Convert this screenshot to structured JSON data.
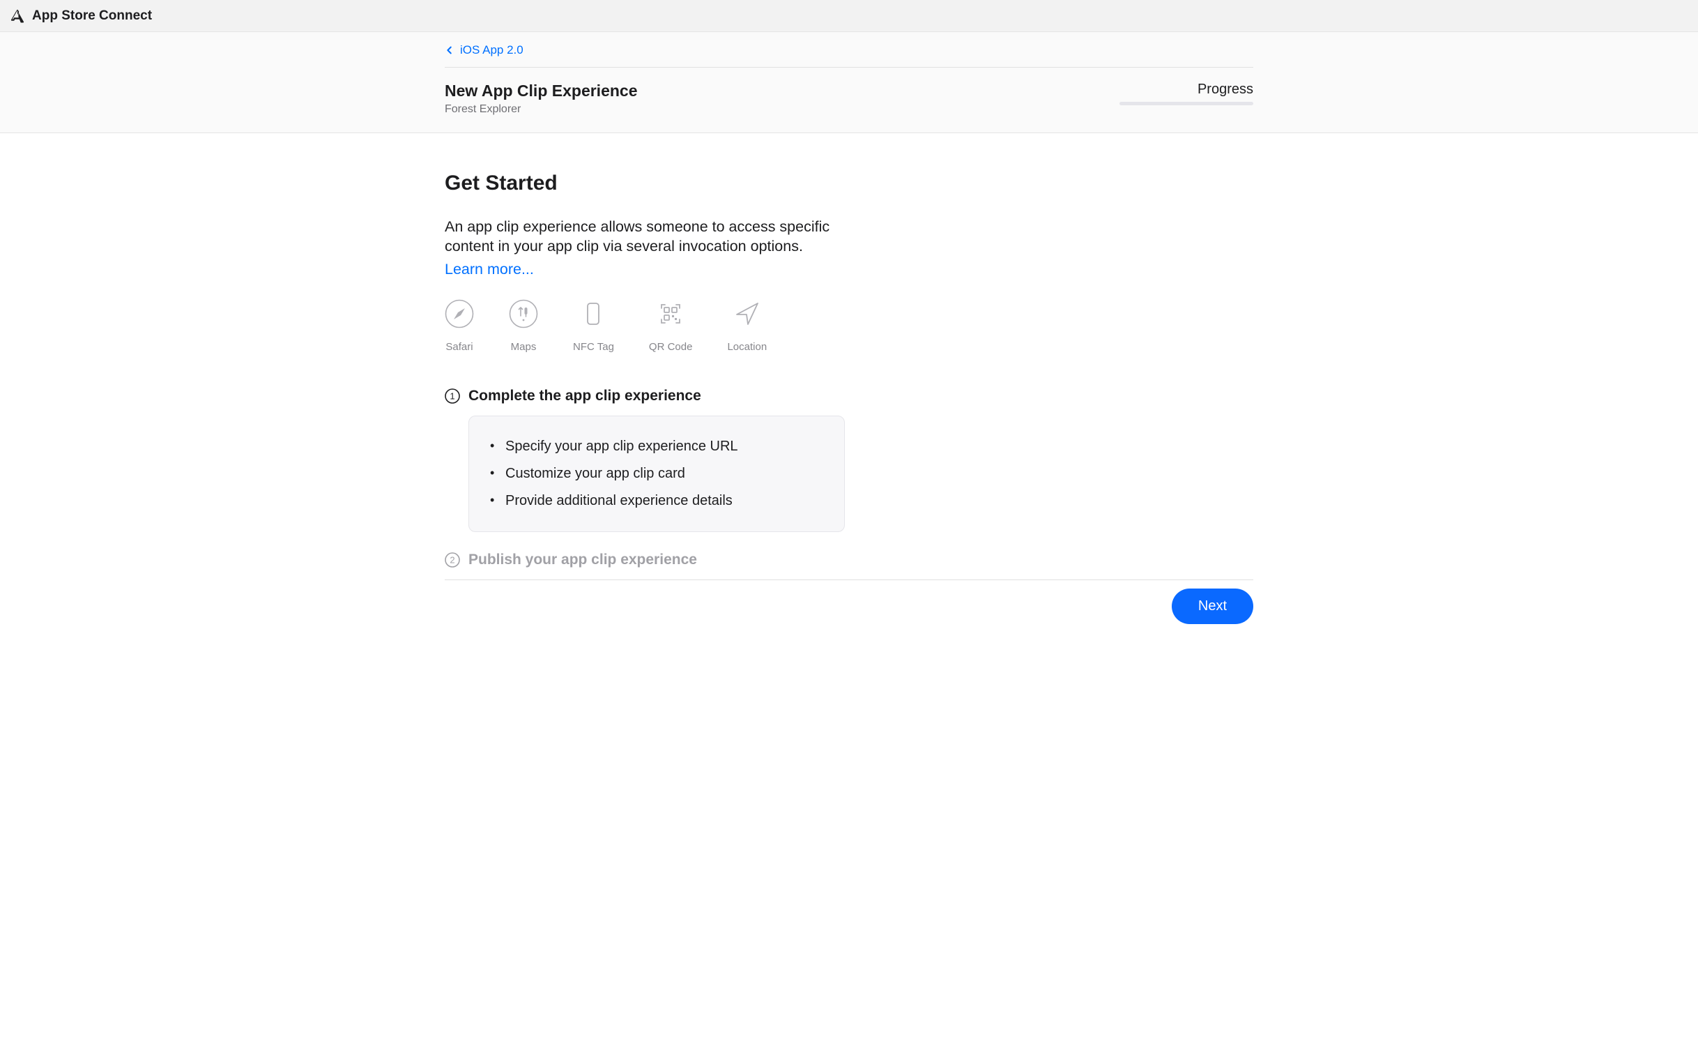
{
  "app": {
    "name": "App Store Connect"
  },
  "breadcrumb": {
    "label": "iOS App 2.0"
  },
  "header": {
    "title": "New App Clip Experience",
    "subtitle": "Forest Explorer",
    "progress_label": "Progress"
  },
  "intro": {
    "heading": "Get Started",
    "description": "An app clip experience allows someone to access specific content in your app clip via several invocation options.",
    "learn_more": "Learn more..."
  },
  "invocations": [
    {
      "icon": "safari",
      "label": "Safari"
    },
    {
      "icon": "maps",
      "label": "Maps"
    },
    {
      "icon": "nfc",
      "label": "NFC Tag"
    },
    {
      "icon": "qr",
      "label": "QR Code"
    },
    {
      "icon": "location",
      "label": "Location"
    }
  ],
  "steps": {
    "one": {
      "title": "Complete the app clip experience",
      "items": [
        "Specify your app clip experience URL",
        "Customize your app clip card",
        "Provide additional experience details"
      ]
    },
    "two": {
      "title": "Publish your app clip experience"
    }
  },
  "actions": {
    "next": "Next"
  }
}
